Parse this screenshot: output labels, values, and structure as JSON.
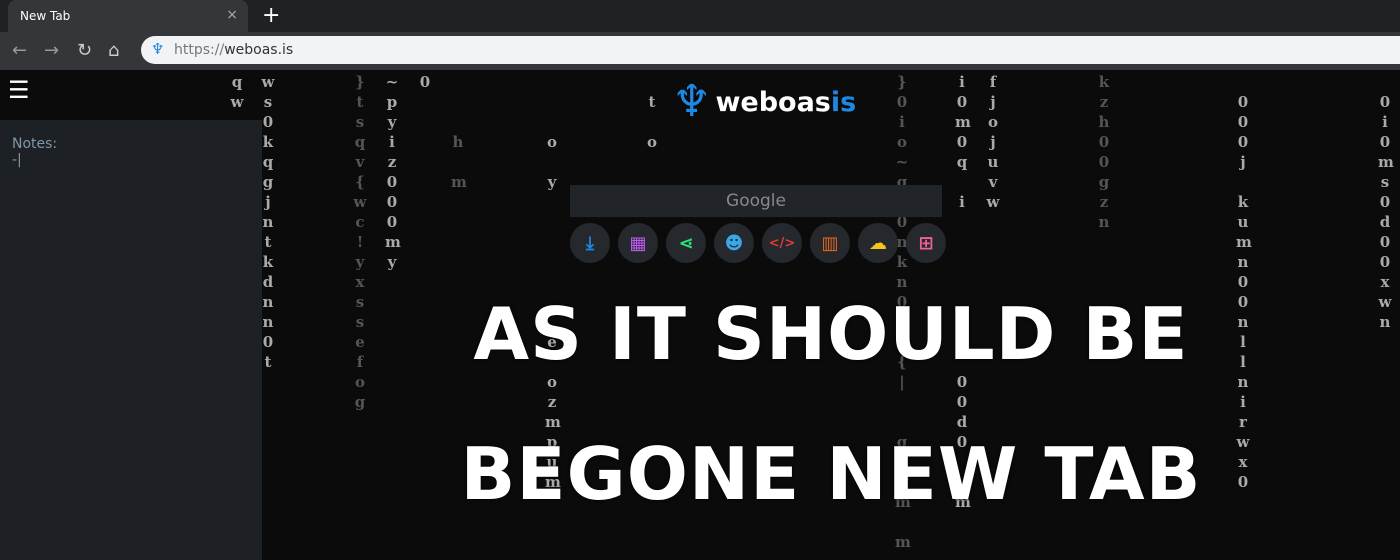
{
  "browser": {
    "tab_title": "New Tab",
    "close": "×",
    "new_tab": "+",
    "url_scheme": "https://",
    "url_host": "weboas.is",
    "nav": {
      "back": "←",
      "forward": "→",
      "reload": "↻",
      "home": "⌂"
    }
  },
  "sidebar": {
    "menu_icon": "☰",
    "notes_label": "Notes:",
    "notes_value": "-|"
  },
  "brand": {
    "name_main": "weboas",
    "name_accent": "is",
    "color": "#1e88e5"
  },
  "search": {
    "placeholder": "Google"
  },
  "shortcuts": [
    {
      "icon": "download-icon",
      "glyph": "⤓",
      "color": "#1e88e5"
    },
    {
      "icon": "film-icon",
      "glyph": "▦",
      "color": "#c05cf0"
    },
    {
      "icon": "share-icon",
      "glyph": "⋖",
      "color": "#2ee07a"
    },
    {
      "icon": "reddit-icon",
      "glyph": "☻",
      "color": "#3aa8e8"
    },
    {
      "icon": "code-icon",
      "glyph": "</>",
      "color": "#e53935"
    },
    {
      "icon": "book-icon",
      "glyph": "▥",
      "color": "#e6661e"
    },
    {
      "icon": "cloud-icon",
      "glyph": "☁",
      "color": "#f5c518"
    },
    {
      "icon": "sitemap-icon",
      "glyph": "⊞",
      "color": "#f06292"
    }
  ],
  "headline": {
    "line1": "AS IT SHOULD BE",
    "line2": "BEGONE NEW TAB"
  },
  "matrix": [
    "q\nw",
    "w\ns\n0\nk\nq\ng\nj\nn\nt\nk\nd\nn\nn\n0\nt",
    "}\nt\ns\nq\nv\n{\nw\nc\n!\ny\nx\ns\ns\ne\nf\no\ng",
    "~\np\ny\ni\nz\n0\n0\n0\nm\ny",
    "0",
    "\n\n\nh\n\nm",
    "\n\n\no\n\ny\n\n\n\n\n\n\n\ne\n\no\nz\nm\np\nu\nm",
    "\nt\n\no",
    "}\n0\ni\no\n~\ng\nd\n0\nn\nk\nn\n0\n\n0\n{\n|\n\n\nq\n\nw\nm\n\nm",
    "f\nj\no\nj\nu\nv\nw",
    "i\n0\nm\n0\nq\n\ni\n\n\n\n\n\n\n\n\n0\n0\nd\n0\n\n\nm",
    "k\nz\nh\n0\n0\ng\nz\nn",
    "\n0\n0\n0\nj\n\nk\nu\nm\nn\n0\n0\nn\nl\nl\nn\ni\nr\nw\nx\n0",
    "\n0\ni\n0\nm\ns\n0\nd\n0\n0\nx\nw\nn"
  ]
}
